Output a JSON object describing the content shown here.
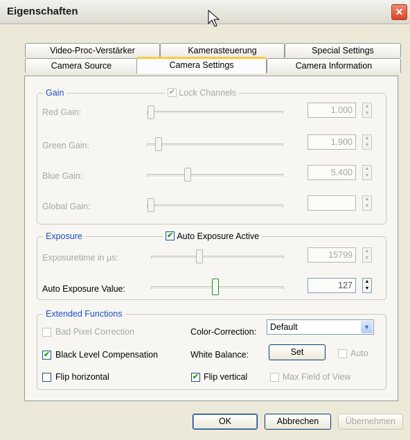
{
  "window": {
    "title": "Eigenschaften",
    "close_glyph": "✕"
  },
  "tabs_row1": [
    "Video-Proc-Verstärker",
    "Kamerasteuerung",
    "Special Settings"
  ],
  "tabs_row2": [
    "Camera Source",
    "Camera Settings",
    "Camera Information"
  ],
  "active_tab": "Camera Settings",
  "gain": {
    "label": "Gain",
    "lock_channels": {
      "label": "Lock Channels",
      "checked": true,
      "enabled": false
    },
    "rows": [
      {
        "label": "Red Gain:",
        "value": "1.000"
      },
      {
        "label": "Green Gain:",
        "value": "1.900"
      },
      {
        "label": "Blue Gain:",
        "value": "5.400"
      },
      {
        "label": "Global Gain:",
        "value": ""
      }
    ]
  },
  "exposure": {
    "label": "Exposure",
    "auto_exposure": {
      "label": "Auto Exposure Active",
      "checked": true
    },
    "rows": [
      {
        "label": "Exposuretime in µs:",
        "value": "15799"
      },
      {
        "label": "Auto Exposure Value:",
        "value": "127"
      }
    ]
  },
  "extended": {
    "label": "Extended Functions",
    "bad_pixel": {
      "label": "Bad Pixel Correction",
      "checked": false,
      "enabled": false
    },
    "black_level": {
      "label": "Black Level Compensation",
      "checked": true
    },
    "flip_h": {
      "label": "Flip horizontal",
      "checked": false
    },
    "color_correction": {
      "label": "Color-Correction:",
      "value": "Default"
    },
    "white_balance": {
      "label": "White Balance:",
      "button": "Set",
      "auto_label": "Auto"
    },
    "flip_v": {
      "label": "Flip vertical",
      "checked": true
    },
    "max_fov": {
      "label": "Max Field of View",
      "checked": false,
      "enabled": false
    }
  },
  "buttons": {
    "ok": "OK",
    "cancel": "Abbrechen",
    "apply": "Übernehmen"
  },
  "check_glyph": "✔",
  "spin_up": "▲",
  "spin_down": "▼",
  "dropdown_glyph": "▼"
}
